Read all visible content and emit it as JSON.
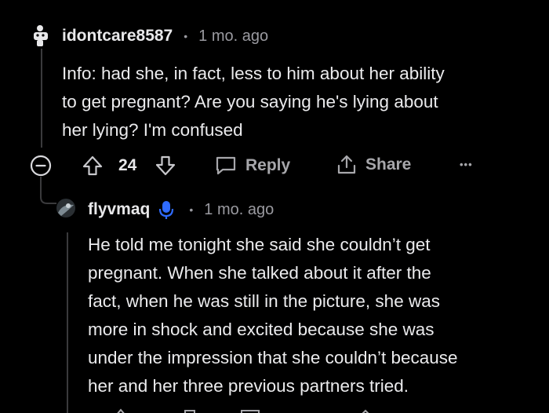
{
  "comment1": {
    "username": "idontcare8587",
    "separator": "•",
    "time": "1 mo. ago",
    "lines": [
      "Info: had she, in fact, less to him about her ability",
      "to get pregnant? Are you saying he's lying about",
      "her lying? I'm confused"
    ],
    "vote_count": "24",
    "reply_label": "Reply",
    "share_label": "Share",
    "more_label": "•••"
  },
  "comment2": {
    "username": "flyvmaq",
    "separator": "•",
    "time": "1 mo. ago",
    "lines": [
      "He told me tonight she said she couldn’t get",
      "pregnant. When she talked about it after the",
      "fact, when he was still in the picture, she was",
      "more in shock and excited because she was",
      "under the impression that she couldn’t because",
      "her and her three previous partners tried."
    ]
  },
  "colors": {
    "background": "#000000",
    "text": "#ebebed",
    "meta": "#9a9aa0",
    "thread_line": "#3a3a3c",
    "mic_blue": "#2f6bff"
  }
}
